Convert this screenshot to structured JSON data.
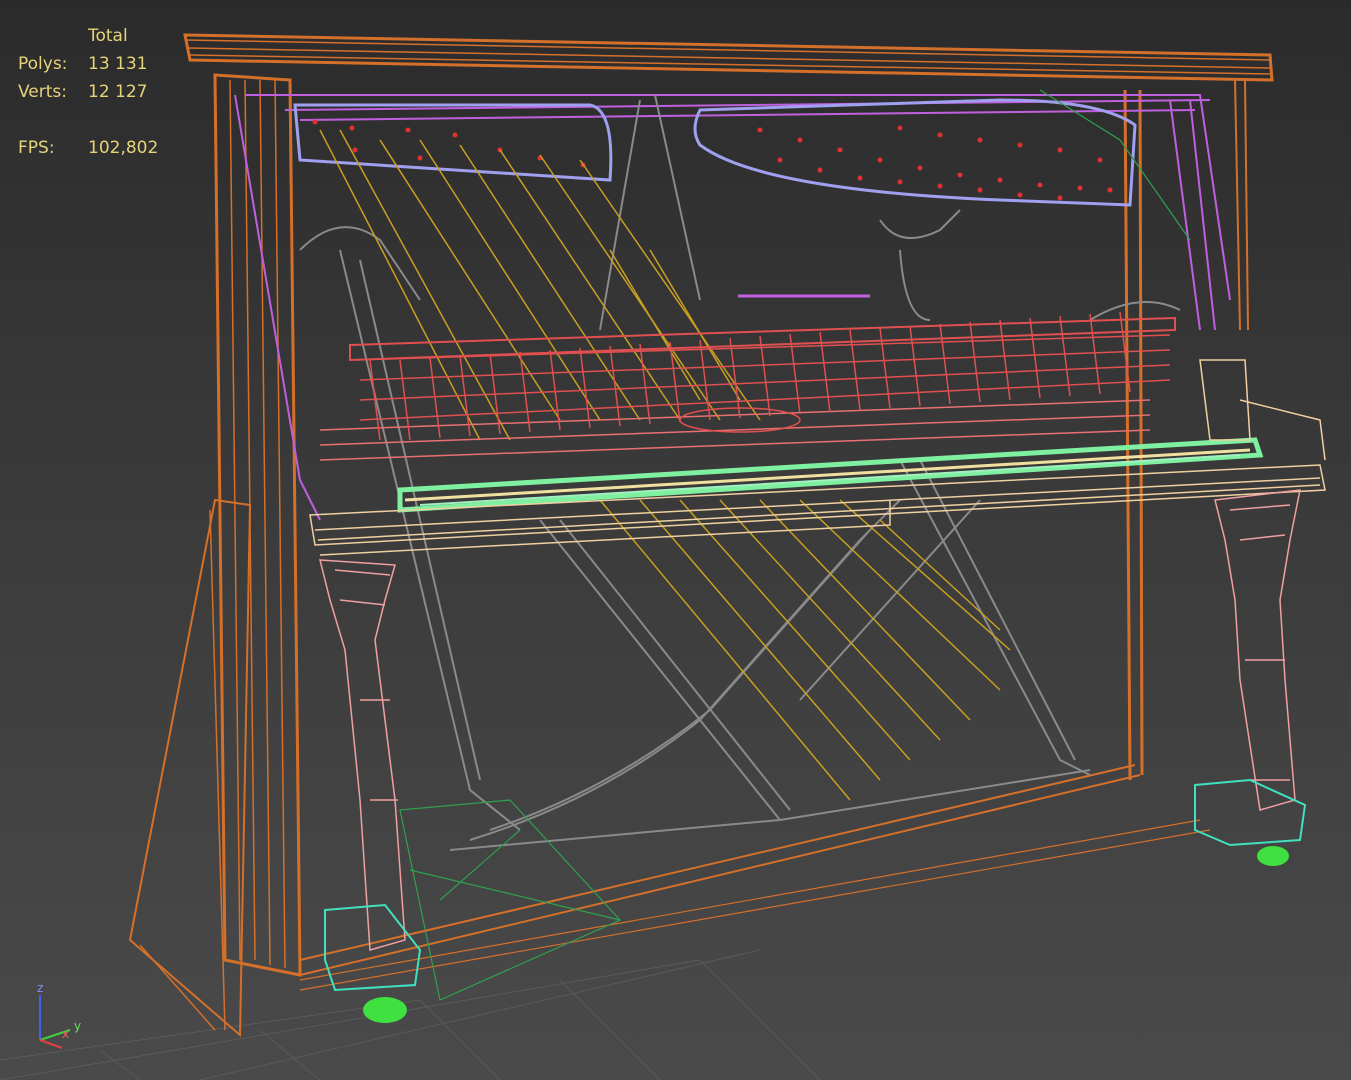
{
  "stats": {
    "header": "Total",
    "polys_label": "Polys:",
    "polys_value": "13 131",
    "verts_label": "Verts:",
    "verts_value": "12 127",
    "fps_label": "FPS:",
    "fps_value": "102,802"
  },
  "gizmo": {
    "z": "z",
    "x": "x",
    "y": "y"
  },
  "colors": {
    "stats_text": "#e6d47a",
    "case": "#d4702a",
    "strings": "#c8a020",
    "frame": "#8a8a8a",
    "hammers": "#e05050",
    "keys": "#7ef0a0",
    "legs": "#f0a0a0",
    "purple": "#c060e0",
    "lavender": "#a0a0f0",
    "feet": "#40e0c0",
    "grid": "#5a5a5a"
  }
}
